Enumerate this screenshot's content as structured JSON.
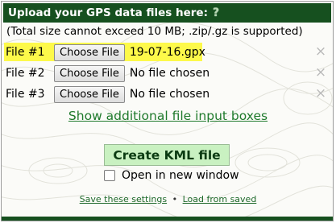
{
  "header": {
    "title": "Upload your GPS data files here:",
    "help_icon": "?"
  },
  "note": "(Total size cannot exceed 10 MB; .zip/.gz is supported)",
  "files": [
    {
      "label": "File #1",
      "button": "Choose File",
      "value": "19-07-16.gpx"
    },
    {
      "label": "File #2",
      "button": "Choose File",
      "value": "No file chosen"
    },
    {
      "label": "File #3",
      "button": "Choose File",
      "value": "No file chosen"
    }
  ],
  "remove_glyph": "×",
  "show_more": "Show additional file input boxes",
  "create_button": "Create KML file",
  "new_window": {
    "label": "Open in new window",
    "checked": false
  },
  "links": {
    "save": "Save these settings",
    "separator": "•",
    "load": "Load from saved"
  },
  "colors": {
    "header_bg": "#16501f",
    "highlight": "#fdf94a",
    "create_bg": "#c9f1c1",
    "link": "#1f7a2c"
  }
}
